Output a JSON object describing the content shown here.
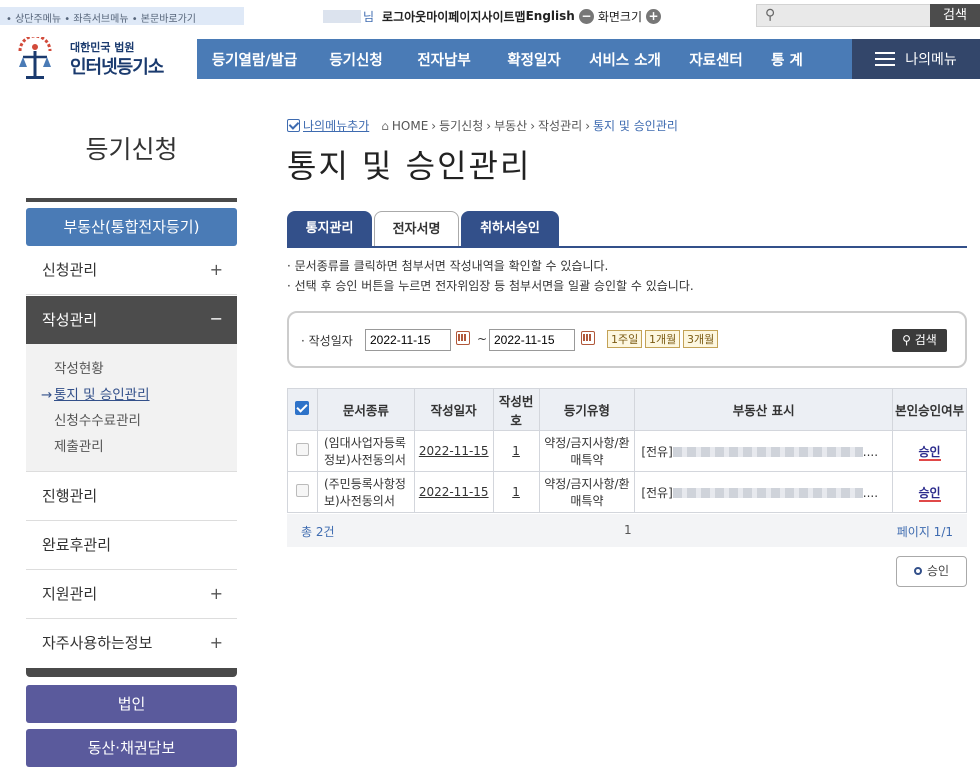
{
  "skip_links": "• 상단주메뉴 • 좌측서브메뉴 • 본문바로가기",
  "util": {
    "user_suffix": "님",
    "logout": "로그아웃",
    "mypage": "마이페이지",
    "sitemap": "사이트맵",
    "english": "English",
    "zoom_minus": "−",
    "zoom_label": "화면크기",
    "zoom_plus": "+",
    "search_button": "검색"
  },
  "logo": {
    "line1": "대한민국 법원",
    "line2": "인터넷등기소"
  },
  "gnb": [
    "등기열람/발급",
    "등기신청",
    "전자납부",
    "확정일자",
    "서비스 소개",
    "자료센터",
    "통 계"
  ],
  "my_menu": "나의메뉴",
  "lnb": {
    "title": "등기신청",
    "section": "부동산(통합전자등기)",
    "items": {
      "apply": "신청관리",
      "write": "작성관리",
      "progress": "진행관리",
      "after": "완료후관리",
      "support": "지원관리",
      "frequent": "자주사용하는정보"
    },
    "plus": "+",
    "minus": "−",
    "sub": [
      "작성현황",
      "통지 및 승인관리",
      "신청수수료관리",
      "제출관리"
    ],
    "current_marker": "→",
    "btn_corp": "법인",
    "btn_movable": "동산·채권담보"
  },
  "breadcrumb": {
    "add_menu": "나의메뉴추가",
    "items": [
      "HOME",
      "등기신청",
      "부동산",
      "작성관리",
      "통지 및 승인관리"
    ]
  },
  "page_title": "통지 및 승인관리",
  "tabs": [
    "통지관리",
    "전자서명",
    "취하서승인"
  ],
  "active_tab": "전자서명",
  "notes": [
    "· 문서종류를 클릭하면 첨부서면 작성내역을 확인할 수 있습니다.",
    "· 선택 후 승인 버튼을 누르면 전자위임장 등 첨부서면을 일괄 승인할 수 있습니다."
  ],
  "filter": {
    "label": "· 작성일자",
    "from": "2022-11-15",
    "to": "2022-11-15",
    "tilde": "~",
    "ranges": [
      "1주일",
      "1개월",
      "3개월"
    ],
    "search": "검색"
  },
  "table": {
    "headers": [
      "문서종류",
      "작성일자",
      "작성번호",
      "등기유형",
      "부동산 표시",
      "본인승인여부"
    ],
    "rows": [
      {
        "doc_type": "(임대사업자등록정보)사전동의서",
        "date": "2022-11-15",
        "no": "1",
        "reg_type": "약정/금지사항/환매특약",
        "property_prefix": "[전유]",
        "property_ellipsis": "....",
        "approval": "승인"
      },
      {
        "doc_type": "(주민등록사항정보)사전동의서",
        "date": "2022-11-15",
        "no": "1",
        "reg_type": "약정/금지사항/환매특약",
        "property_prefix": "[전유]",
        "property_ellipsis": "....",
        "approval": "승인"
      }
    ]
  },
  "footer": {
    "total": "총 2건",
    "page": "1",
    "page_info": "페이지 1/1"
  },
  "approve_button": "승인",
  "colors": {
    "primary": "#4a7bb6",
    "dark_nav": "#33466a",
    "tab": "#33508a",
    "lnb_button": "#5a5a9c",
    "accent_red": "#e04848"
  }
}
